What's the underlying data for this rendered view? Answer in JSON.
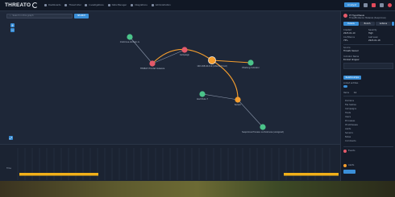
{
  "app": {
    "brand": "THREATO"
  },
  "nav": [
    {
      "label": "Dashboards"
    },
    {
      "label": "Threat Intel"
    },
    {
      "label": "Investigations"
    },
    {
      "label": "Data Manager"
    },
    {
      "label": "Integrations"
    },
    {
      "label": "Administration"
    }
  ],
  "topbar": {
    "user_label": "Analyst"
  },
  "search": {
    "placeholder": "Search in this graph",
    "button": "SEARCH"
  },
  "zoom": {
    "in": "+",
    "out": "−",
    "fit": "⤢"
  },
  "graph": {
    "nodes": [
      {
        "id": "n1",
        "label": "malicious-domain.ru",
        "color": "#4bc38a"
      },
      {
        "id": "n2",
        "label": "THREAT: Emotet malware",
        "color": "#e55a6a"
      },
      {
        "id": "n3",
        "label": "Campaign",
        "color": "#e55a6a"
      },
      {
        "id": "n4",
        "label": "192.168.44.210 (infected host)",
        "color": "#f59e2e"
      },
      {
        "id": "n5",
        "label": "Phishing Indicator",
        "color": "#4bc38a"
      },
      {
        "id": "n6",
        "label": "Alert Rule 7",
        "color": "#4bc38a"
      },
      {
        "id": "n7",
        "label": "Sensor",
        "color": "#f59e2e"
      },
      {
        "id": "n8",
        "label": "Suspicious Process: svchost.exe (unsigned)",
        "color": "#4bc38a"
      }
    ],
    "colors": {
      "highlight": "#f59e2e",
      "edge": "#8a96aa"
    }
  },
  "panel": {
    "title": "IT Hypothesis",
    "subtitle": "ThreatEvidence: Malware (Suspicious)",
    "tabs": [
      "Details",
      "Enrich",
      "Actions"
    ],
    "fields": [
      {
        "label": "Created",
        "value": "2023-01-10"
      },
      {
        "label": "Severity",
        "value": "High"
      },
      {
        "label": "Confidence",
        "value": "75%"
      },
      {
        "label": "Last seen",
        "value": "2023-01-18"
      }
    ],
    "source_label": "Source",
    "source_value": "Threato Sensor",
    "description_label": "Indicator Name",
    "description_value": "Emotet dropper",
    "section_label": "Relationships",
    "relations_label": "Linked entities",
    "list": [
      "Domains",
      "File hashes",
      "Campaigns",
      "Hosts",
      "Users",
      "Processes",
      "IP Addresses",
      "Alerts",
      "Sensors",
      "Notes",
      "Comments"
    ],
    "count_label": "Items",
    "count_value": "11",
    "bottom_labels": [
      "Events",
      "Alerts"
    ],
    "accent": "#3a8fd8"
  },
  "timeline": {
    "left_label": "Time",
    "colors": {
      "bar": "#f2b019"
    }
  }
}
